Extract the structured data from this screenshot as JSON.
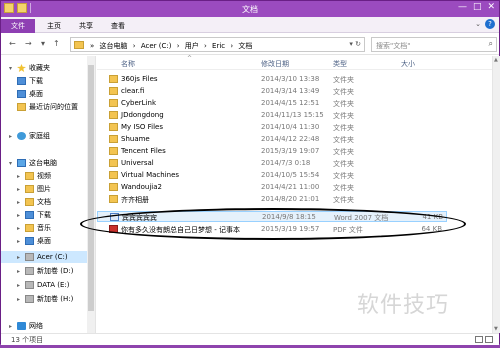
{
  "window": {
    "title": "文档",
    "controls": [
      "—",
      "□",
      "✕"
    ]
  },
  "ribbon": {
    "tabs": [
      "文件",
      "主页",
      "共享",
      "查看"
    ],
    "expand_glyph": "⌄",
    "help_glyph": "?"
  },
  "nav": {
    "back": "←",
    "forward": "→",
    "recent": "▾",
    "up": "↑"
  },
  "address": {
    "crumbs": [
      "»",
      "这台电脑",
      "›",
      "Acer (C:)",
      "›",
      "用户",
      "›",
      "Eric",
      "›",
      "文档"
    ],
    "dropdown": "▾",
    "refresh": "↻"
  },
  "search": {
    "placeholder": "搜索\"文档\"",
    "icon": "⌕"
  },
  "sidebar": {
    "items": [
      {
        "label": "收藏夹",
        "icon": "star-icon"
      },
      {
        "label": "下载",
        "icon": "folder-icon"
      },
      {
        "label": "桌面",
        "icon": "folder-icon"
      },
      {
        "label": "最近访问的位置",
        "icon": "folder-icon"
      },
      {
        "label": "家庭组",
        "icon": "homegroup-icon"
      },
      {
        "label": "这台电脑",
        "icon": "computer-icon"
      },
      {
        "label": "视频",
        "icon": "folder-icon"
      },
      {
        "label": "图片",
        "icon": "folder-icon"
      },
      {
        "label": "文档",
        "icon": "folder-icon"
      },
      {
        "label": "下载",
        "icon": "folder-icon"
      },
      {
        "label": "音乐",
        "icon": "folder-icon"
      },
      {
        "label": "桌面",
        "icon": "folder-icon"
      },
      {
        "label": "Acer (C:)",
        "icon": "drive-icon"
      },
      {
        "label": "新加卷 (D:)",
        "icon": "drive-icon"
      },
      {
        "label": "DATA (E:)",
        "icon": "drive-icon"
      },
      {
        "label": "新加卷 (H:)",
        "icon": "drive-icon"
      },
      {
        "label": "网络",
        "icon": "network-icon"
      }
    ]
  },
  "columns": {
    "name": "名称",
    "date": "修改日期",
    "type": "类型",
    "size": "大小",
    "sort_glyph": "^"
  },
  "files": [
    {
      "name": "360js Files",
      "date": "2014/3/10 13:38",
      "type": "文件夹",
      "size": "",
      "kind": "folder"
    },
    {
      "name": "clear.fi",
      "date": "2014/3/14 13:49",
      "type": "文件夹",
      "size": "",
      "kind": "folder"
    },
    {
      "name": "CyberLink",
      "date": "2014/4/15 12:51",
      "type": "文件夹",
      "size": "",
      "kind": "folder"
    },
    {
      "name": "JDdongdong",
      "date": "2014/11/13 15:15",
      "type": "文件夹",
      "size": "",
      "kind": "folder"
    },
    {
      "name": "My ISO Files",
      "date": "2014/10/4 11:30",
      "type": "文件夹",
      "size": "",
      "kind": "folder"
    },
    {
      "name": "Shuame",
      "date": "2014/4/12 22:48",
      "type": "文件夹",
      "size": "",
      "kind": "folder"
    },
    {
      "name": "Tencent Files",
      "date": "2015/3/19 19:07",
      "type": "文件夹",
      "size": "",
      "kind": "folder"
    },
    {
      "name": "Universal",
      "date": "2014/7/3 0:18",
      "type": "文件夹",
      "size": "",
      "kind": "folder"
    },
    {
      "name": "Virtual Machines",
      "date": "2014/10/5 15:54",
      "type": "文件夹",
      "size": "",
      "kind": "folder"
    },
    {
      "name": "Wandoujia2",
      "date": "2014/4/21 11:00",
      "type": "文件夹",
      "size": "",
      "kind": "folder"
    },
    {
      "name": "齐齐相册",
      "date": "2014/8/20 21:01",
      "type": "文件夹",
      "size": "",
      "kind": "folder"
    },
    {
      "name": "宾宾宾宾宾",
      "date": "2014/9/8 18:15",
      "type": "Word 2007 文档",
      "size": "41 KB",
      "kind": "doc"
    },
    {
      "name": "你有多久没有朗总自己日梦想 - 记事本",
      "date": "2015/3/19 19:57",
      "type": "PDF 文件",
      "size": "64 KB",
      "kind": "pdf"
    }
  ],
  "status": {
    "count": "13 个项目"
  },
  "watermark": "软件技巧",
  "colors": {
    "titlebar": "#9b4bbf",
    "file_tab": "#8e3fb3",
    "selection": "#cde8ff"
  }
}
